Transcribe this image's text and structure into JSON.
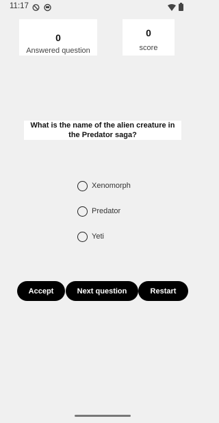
{
  "status_bar": {
    "time": "11:17",
    "icons": [
      "shield-icon",
      "face-icon",
      "wifi-icon",
      "battery-icon"
    ]
  },
  "stats": {
    "answered_value": "0",
    "answered_label": "Answered question",
    "score_value": "0",
    "score_label": "score"
  },
  "question": {
    "text": "What is the name of the alien creature in the Predator saga?"
  },
  "options": [
    {
      "label": "Xenomorph",
      "selected": false
    },
    {
      "label": "Predator",
      "selected": false
    },
    {
      "label": "Yeti",
      "selected": false
    }
  ],
  "buttons": {
    "accept": "Accept",
    "next": "Next question",
    "restart": "Restart"
  },
  "colors": {
    "background": "#f0f0f0",
    "card": "#ffffff",
    "button": "#000000",
    "button_text": "#ffffff"
  }
}
